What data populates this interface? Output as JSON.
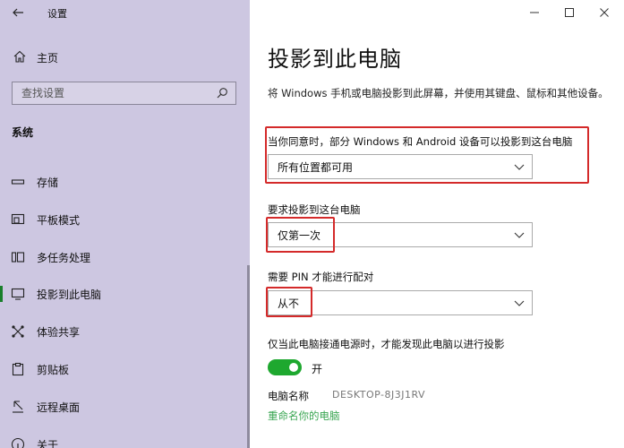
{
  "app": {
    "title": "设置"
  },
  "sidebar": {
    "home": "主页",
    "search_placeholder": "查找设置",
    "section_title": "系统",
    "items": [
      {
        "label": "存储",
        "icon": "storage-icon"
      },
      {
        "label": "平板模式",
        "icon": "tablet-mode-icon"
      },
      {
        "label": "多任务处理",
        "icon": "multitasking-icon"
      },
      {
        "label": "投影到此电脑",
        "icon": "projecting-icon",
        "active": true
      },
      {
        "label": "体验共享",
        "icon": "shared-experiences-icon"
      },
      {
        "label": "剪贴板",
        "icon": "clipboard-icon"
      },
      {
        "label": "远程桌面",
        "icon": "remote-desktop-icon"
      },
      {
        "label": "关于",
        "icon": "about-icon"
      }
    ]
  },
  "main": {
    "title": "投影到此电脑",
    "description": "将 Windows 手机或电脑投影到此屏幕，并使用其键盘、鼠标和其他设备。",
    "setting1": {
      "label": "当你同意时，部分 Windows 和 Android 设备可以投影到这台电脑",
      "value": "所有位置都可用"
    },
    "setting2": {
      "label": "要求投影到这台电脑",
      "value": "仅第一次"
    },
    "setting3": {
      "label": "需要 PIN 才能进行配对",
      "value": "从不"
    },
    "power_setting": {
      "label": "仅当此电脑接通电源时，才能发现此电脑以进行投影",
      "toggle_state": "开",
      "on": true
    },
    "pc_name": {
      "label": "电脑名称",
      "value": "DESKTOP-8J3J1RV"
    },
    "rename_link": "重命名你的电脑"
  },
  "colors": {
    "sidebar_bg": "#cdc7e1",
    "accent": "#1ea82f",
    "highlight_box": "#d42a2a",
    "link": "#3aa652"
  }
}
